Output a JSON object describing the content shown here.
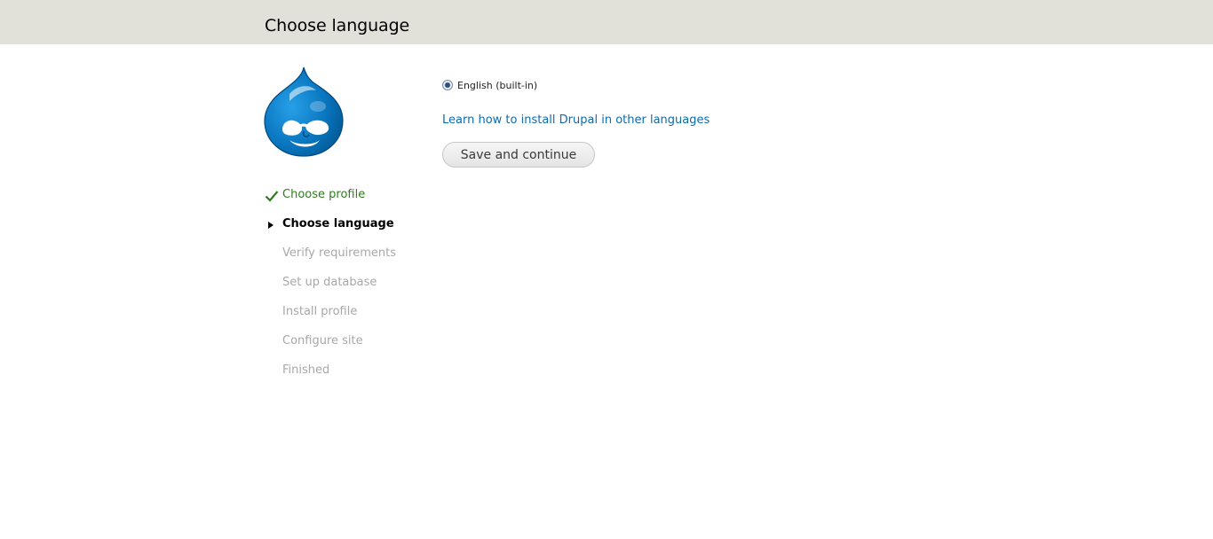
{
  "header": {
    "title": "Choose language"
  },
  "logo": {
    "icon": "drupal-drop-logo-icon",
    "color": "#0a77c0"
  },
  "steps": [
    {
      "label": "Choose profile",
      "state": "done",
      "icon": "checkmark-icon",
      "color": "#2f7d1e"
    },
    {
      "label": "Choose language",
      "state": "active",
      "icon": "arrow-right-icon",
      "color": "#000000"
    },
    {
      "label": "Verify requirements",
      "state": "pending",
      "color": "#a8a8a8"
    },
    {
      "label": "Set up database",
      "state": "pending",
      "color": "#a8a8a8"
    },
    {
      "label": "Install profile",
      "state": "pending",
      "color": "#a8a8a8"
    },
    {
      "label": "Configure site",
      "state": "pending",
      "color": "#a8a8a8"
    },
    {
      "label": "Finished",
      "state": "pending",
      "color": "#a8a8a8"
    }
  ],
  "form": {
    "language_option": {
      "label": "English (built-in)",
      "selected": true
    },
    "learn_link": "Learn how to install Drupal in other languages",
    "link_color": "#0d6bb1",
    "submit_label": "Save and continue"
  }
}
